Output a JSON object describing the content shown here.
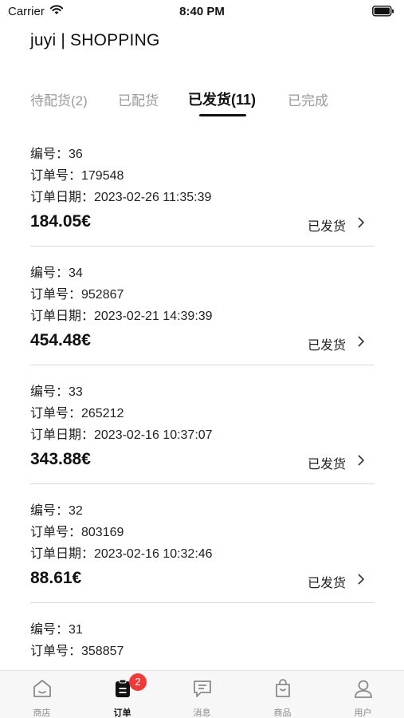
{
  "status_bar": {
    "carrier": "Carrier",
    "time": "8:40 PM"
  },
  "app_title": "juyi | SHOPPING",
  "tabs": [
    {
      "label": "待配货(2)"
    },
    {
      "label": "已配货"
    },
    {
      "label": "已发货(11)"
    },
    {
      "label": "已完成"
    }
  ],
  "orders": [
    {
      "number": "编号：36",
      "order_no": "订单号：179548",
      "date": "订单日期：2023-02-26 11:35:39",
      "price": "184.05€",
      "status": "已发货"
    },
    {
      "number": "编号：34",
      "order_no": "订单号：952867",
      "date": "订单日期：2023-02-21 14:39:39",
      "price": "454.48€",
      "status": "已发货"
    },
    {
      "number": "编号：33",
      "order_no": "订单号：265212",
      "date": "订单日期：2023-02-16 10:37:07",
      "price": "343.88€",
      "status": "已发货"
    },
    {
      "number": "编号：32",
      "order_no": "订单号：803169",
      "date": "订单日期：2023-02-16 10:32:46",
      "price": "88.61€",
      "status": "已发货"
    },
    {
      "number": "编号：31",
      "order_no": "订单号：358857",
      "date": "",
      "price": "",
      "status": ""
    }
  ],
  "tabbar": {
    "items": [
      {
        "label": "商店",
        "icon": "shop-icon"
      },
      {
        "label": "订单",
        "icon": "orders-icon"
      },
      {
        "label": "消息",
        "icon": "message-icon"
      },
      {
        "label": "商品",
        "icon": "bag-icon"
      },
      {
        "label": "用户",
        "icon": "user-icon"
      }
    ],
    "orders_badge": "2"
  }
}
